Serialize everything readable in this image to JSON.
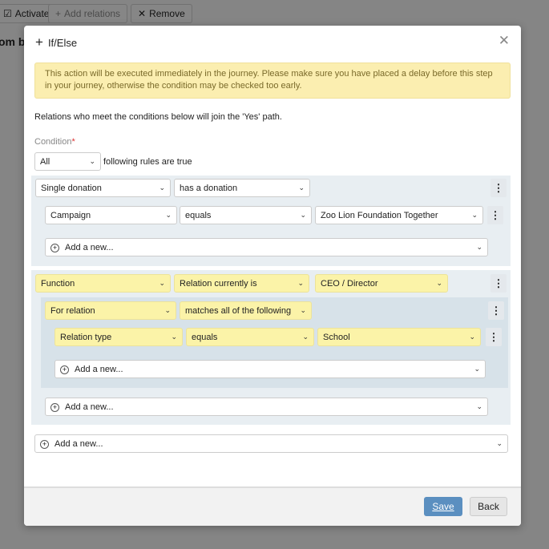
{
  "toolbar": {
    "activate": "Activate",
    "add_relations": "Add relations",
    "remove": "Remove"
  },
  "background_title": "om b",
  "modal": {
    "title": "If/Else",
    "warning": "This action will be executed immediately in the journey. Please make sure you have placed a delay before this step in your journey, otherwise the condition may be checked too early.",
    "intro": "Relations who meet the conditions below will join the 'Yes' path.",
    "condition_label": "Condition",
    "required_mark": "*",
    "match_select": "All",
    "match_suffix": "following rules are true",
    "group1": {
      "field": "Single donation",
      "operator": "has a donation",
      "rule": {
        "field": "Campaign",
        "operator": "equals",
        "value": "Zoo Lion Foundation Together"
      },
      "add_new": "Add a new..."
    },
    "group2": {
      "field": "Function",
      "operator": "Relation currently is",
      "value": "CEO / Director",
      "sub": {
        "field": "For relation",
        "operator": "matches all of the following",
        "rule": {
          "field": "Relation type",
          "operator": "equals",
          "value": "School"
        },
        "add_new": "Add a new..."
      },
      "add_new": "Add a new..."
    },
    "add_new": "Add a new...",
    "save": "Save",
    "back": "Back"
  },
  "colors": {
    "warning_bg": "#fbeeb0",
    "highlight": "#fbf3a8",
    "primary": "#5b8fc0",
    "group_bg": "#e8eef2"
  }
}
